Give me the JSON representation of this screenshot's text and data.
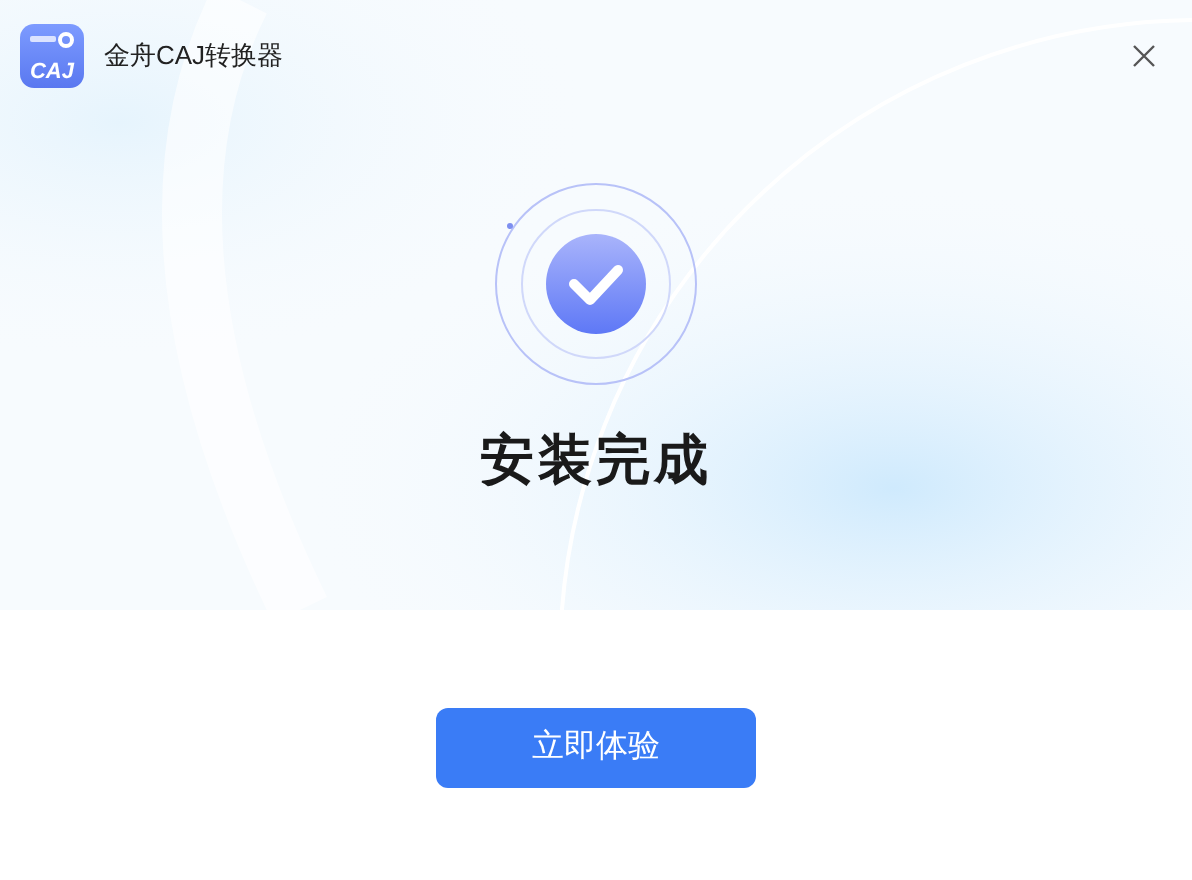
{
  "window": {
    "title": "金舟CAJ转换器",
    "app_icon_text": "CAJ"
  },
  "status": {
    "title": "安装完成"
  },
  "buttons": [
    {
      "label": "立即体验"
    }
  ]
}
